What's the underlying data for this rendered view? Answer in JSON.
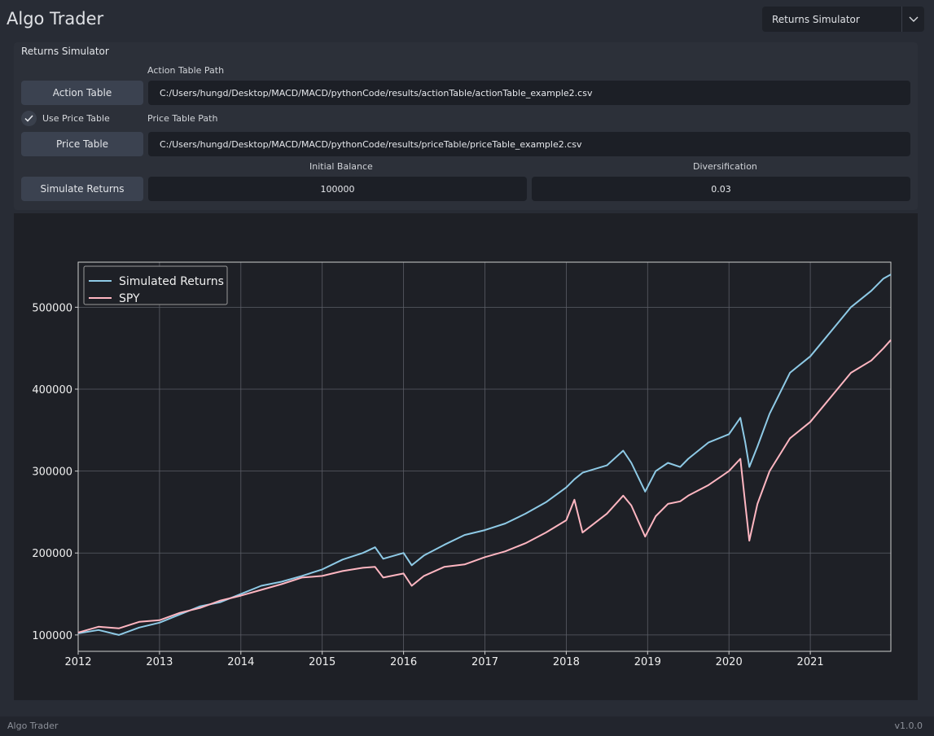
{
  "app": {
    "title": "Algo Trader"
  },
  "page_select": {
    "value": "Returns Simulator",
    "arrow_icon": "chevron-down-icon"
  },
  "panel": {
    "title": "Returns Simulator",
    "action_table": {
      "button_label": "Action Table",
      "path_label": "Action Table Path",
      "path_value": "C:/Users/hungd/Desktop/MACD/MACD/pythonCode/results/actionTable/actionTable_example2.csv"
    },
    "use_price_table": {
      "label": "Use Price Table",
      "checked": true,
      "check_icon": "checkmark-icon"
    },
    "price_table": {
      "button_label": "Price Table",
      "path_label": "Price Table Path",
      "path_value": "C:/Users/hungd/Desktop/MACD/MACD/pythonCode/results/priceTable/priceTable_example2.csv"
    },
    "simulate": {
      "button_label": "Simulate Returns",
      "initial_balance_label": "Initial Balance",
      "initial_balance_value": "100000",
      "diversification_label": "Diversification",
      "diversification_value": "0.03"
    }
  },
  "chart_data": {
    "type": "line",
    "title": "",
    "xlabel": "",
    "ylabel": "",
    "xlim": [
      2012.0,
      2021.99
    ],
    "ylim": [
      80000,
      555000
    ],
    "xticks": [
      "2012",
      "2013",
      "2014",
      "2015",
      "2016",
      "2017",
      "2018",
      "2019",
      "2020",
      "2021"
    ],
    "yticks": [
      "100000",
      "200000",
      "300000",
      "400000",
      "500000"
    ],
    "ytick_values": [
      100000,
      200000,
      300000,
      400000,
      500000
    ],
    "grid": true,
    "legend_position": "top-left",
    "series": [
      {
        "name": "Simulated Returns",
        "color": "#8ecae6",
        "x": [
          2012.0,
          2012.25,
          2012.5,
          2012.75,
          2013.0,
          2013.25,
          2013.5,
          2013.75,
          2014.0,
          2014.25,
          2014.5,
          2014.75,
          2015.0,
          2015.25,
          2015.5,
          2015.65,
          2015.75,
          2016.0,
          2016.1,
          2016.25,
          2016.5,
          2016.75,
          2017.0,
          2017.25,
          2017.5,
          2017.75,
          2018.0,
          2018.1,
          2018.2,
          2018.5,
          2018.7,
          2018.8,
          2018.97,
          2019.1,
          2019.25,
          2019.4,
          2019.5,
          2019.75,
          2020.0,
          2020.14,
          2020.2,
          2020.25,
          2020.35,
          2020.5,
          2020.75,
          2021.0,
          2021.25,
          2021.5,
          2021.75,
          2021.9,
          2021.99
        ],
        "y": [
          102000,
          106000,
          100000,
          109000,
          115000,
          125000,
          135000,
          140000,
          150000,
          160000,
          165000,
          172000,
          180000,
          192000,
          200000,
          207000,
          193000,
          200000,
          185000,
          197000,
          210000,
          222000,
          228000,
          236000,
          248000,
          262000,
          280000,
          290000,
          298000,
          307000,
          325000,
          310000,
          275000,
          300000,
          310000,
          305000,
          315000,
          335000,
          345000,
          365000,
          335000,
          305000,
          330000,
          370000,
          420000,
          440000,
          470000,
          500000,
          520000,
          535000,
          540000
        ]
      },
      {
        "name": "SPY",
        "color": "#ffb6c1",
        "x": [
          2012.0,
          2012.25,
          2012.5,
          2012.75,
          2013.0,
          2013.25,
          2013.5,
          2013.75,
          2014.0,
          2014.25,
          2014.5,
          2014.75,
          2015.0,
          2015.25,
          2015.5,
          2015.65,
          2015.75,
          2016.0,
          2016.1,
          2016.25,
          2016.5,
          2016.75,
          2017.0,
          2017.25,
          2017.5,
          2017.75,
          2018.0,
          2018.1,
          2018.2,
          2018.5,
          2018.7,
          2018.8,
          2018.97,
          2019.1,
          2019.25,
          2019.4,
          2019.5,
          2019.75,
          2020.0,
          2020.14,
          2020.2,
          2020.25,
          2020.35,
          2020.5,
          2020.75,
          2021.0,
          2021.25,
          2021.5,
          2021.75,
          2021.9,
          2021.99
        ],
        "y": [
          103000,
          110000,
          108000,
          116000,
          118000,
          127000,
          133000,
          142000,
          148000,
          155000,
          162000,
          170000,
          172000,
          178000,
          182000,
          183000,
          170000,
          175000,
          160000,
          172000,
          183000,
          186000,
          195000,
          202000,
          212000,
          225000,
          240000,
          265000,
          225000,
          248000,
          270000,
          258000,
          220000,
          245000,
          260000,
          263000,
          270000,
          283000,
          300000,
          315000,
          260000,
          215000,
          260000,
          300000,
          340000,
          360000,
          390000,
          420000,
          435000,
          450000,
          460000
        ]
      }
    ]
  },
  "footer": {
    "left": "Algo Trader",
    "right": "v1.0.0"
  }
}
